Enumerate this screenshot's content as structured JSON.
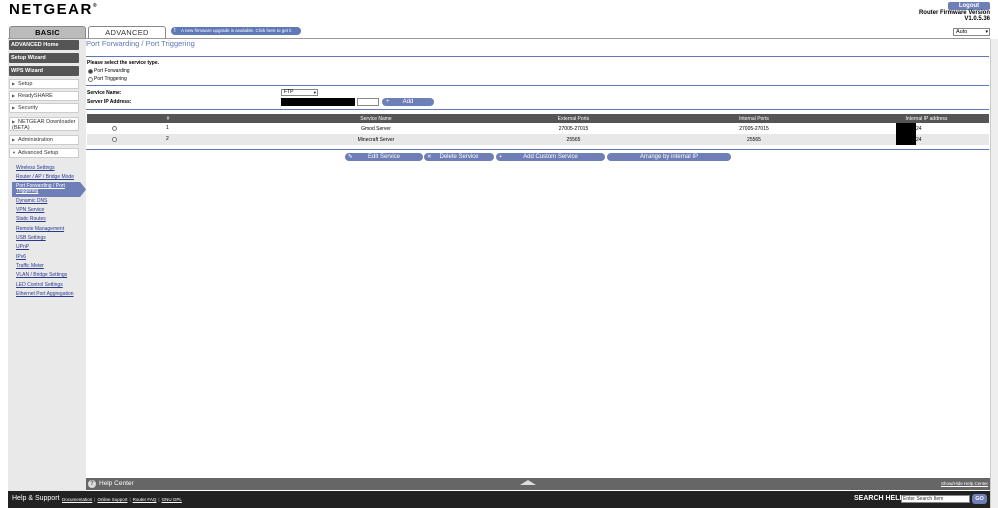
{
  "header": {
    "logo": "NETGEAR",
    "logo_mark": "®",
    "logout_label": "Logout",
    "fw_label": "Router Firmware Version",
    "fw_version": "V1.0.5.36",
    "language": "Auto",
    "firmware_notice": "A new firmware upgrade is available. Click here to get it",
    "notice_icon": "!"
  },
  "tabs": {
    "basic": "BASIC",
    "advanced": "ADVANCED"
  },
  "sidebar": {
    "buttons": [
      "ADVANCED Home",
      "Setup Wizard",
      "WPS Wizard"
    ],
    "sections": [
      "Setup",
      "ReadySHARE",
      "Security",
      "NETGEAR Downloader (BETA)",
      "Administration",
      "Advanced Setup"
    ],
    "sub_items": [
      "Wireless Settings",
      "Router / AP / Bridge Mode",
      "Port Forwarding / Port Triggering",
      "Dynamic DNS",
      "VPN Service",
      "Static Routes",
      "Remote Management",
      "USB Settings",
      "UPnP",
      "IPv6",
      "Traffic Meter",
      "VLAN / Bridge Settings",
      "LED Control Settings",
      "Ethernet Port Aggregation"
    ]
  },
  "main": {
    "title": "Port Forwarding / Port Triggering",
    "select_type_label": "Please select the service type.",
    "radio_port_forwarding": "Port Forwarding",
    "radio_port_triggering": "Port Triggering",
    "service_name_label": "Service Name:",
    "server_ip_label": "Server IP Address:",
    "service_name_value": "FTP",
    "add_label": "Add",
    "table": {
      "headers": [
        "#",
        "Service Name",
        "External Ports",
        "Internal Ports",
        "Internal IP address"
      ],
      "rows": [
        {
          "num": "1",
          "name": "Gmod Server",
          "ext": "27005-27015",
          "int": "27005-27015",
          "ip_suffix": "24"
        },
        {
          "num": "2",
          "name": "Minecraft Server",
          "ext": "25565",
          "int": "25565",
          "ip_suffix": "24"
        }
      ]
    },
    "buttons": {
      "edit": "Edit Service",
      "delete": "Delete Service",
      "add_custom": "Add Custom Service",
      "arrange": "Arrange by internal IP"
    }
  },
  "help_center": {
    "title": "Help Center",
    "toggle": "Show/Hide Help Center"
  },
  "footer": {
    "title": "Help & Support",
    "links": [
      "Documentation",
      "Online Support",
      "Router FAQ",
      "GNU GPL"
    ],
    "search_label": "SEARCH HELP",
    "search_placeholder": "Enter Search Item",
    "go_label": "GO"
  },
  "colors": {
    "accent": "#6d7fb6",
    "title_blue": "#5f78b6",
    "dark": "#555555"
  }
}
